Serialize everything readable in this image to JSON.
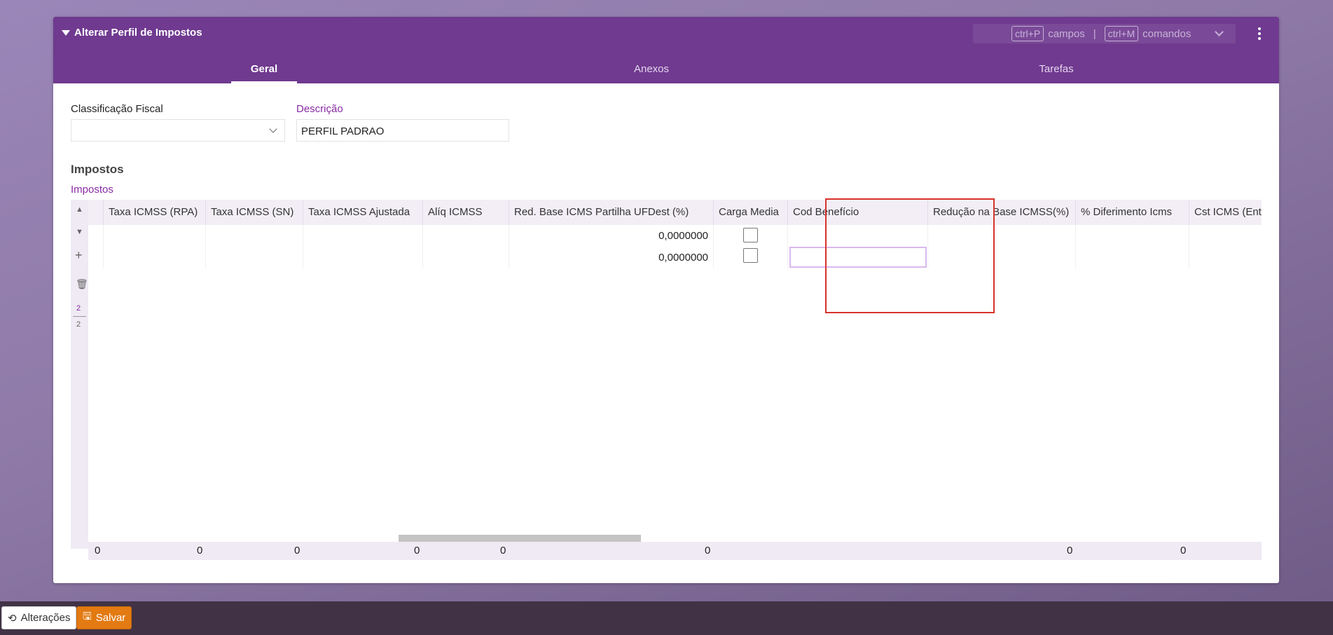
{
  "panel": {
    "title": "Alterar Perfil de Impostos",
    "shortcuts": {
      "fields_key": "ctrl+P",
      "fields_label": "campos",
      "separator": "|",
      "commands_key": "ctrl+M",
      "commands_label": "comandos"
    },
    "tabs": [
      {
        "label": "Geral",
        "active": true
      },
      {
        "label": "Anexos",
        "active": false
      },
      {
        "label": "Tarefas",
        "active": false
      }
    ]
  },
  "form": {
    "classificacao_label": "Classificação Fiscal",
    "classificacao_value": "",
    "descricao_label": "Descrição",
    "descricao_value": "PERFIL PADRAO"
  },
  "section": {
    "title": "Impostos",
    "subtitle": "Impostos"
  },
  "grid": {
    "columns": [
      "Taxa ICMSS (RPA)",
      "Taxa ICMSS (SN)",
      "Taxa ICMSS Ajustada",
      "Alíq ICMSS",
      "Red. Base ICMS Partilha UFDest (%)",
      "Carga Media",
      "Cod Benefício",
      "Redução na Base ICMSS(%)",
      "% Diferimento Icms",
      "Cst ICMS (Entr"
    ],
    "rows": [
      {
        "red_base": "0,0000000",
        "carga_media": false,
        "cod_beneficio": ""
      },
      {
        "red_base": "0,0000000",
        "carga_media": false,
        "cod_beneficio": ""
      }
    ],
    "pager": {
      "current": "2",
      "total": "2"
    },
    "totals": [
      "0",
      "0",
      "0",
      "0",
      "0",
      "0",
      "0",
      "0"
    ]
  },
  "bottom": {
    "changes_label": "Alterações",
    "save_label": "Salvar"
  }
}
